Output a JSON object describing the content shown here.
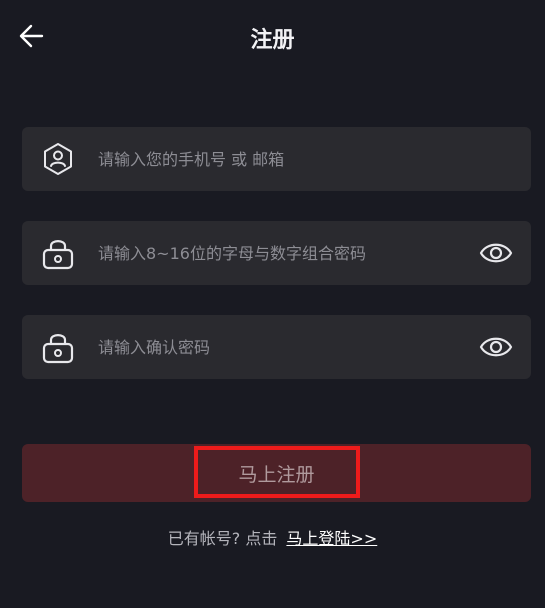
{
  "header": {
    "title": "注册",
    "back_icon": "arrow-left-icon"
  },
  "fields": {
    "account": {
      "placeholder": "请输入您的手机号 或 邮箱",
      "value": "",
      "icon": "user-icon"
    },
    "password": {
      "placeholder": "请输入8~16位的字母与数字组合密码",
      "value": "",
      "icon": "lock-icon",
      "toggle_icon": "eye-icon"
    },
    "confirm": {
      "placeholder": "请输入确认密码",
      "value": "",
      "icon": "lock-icon",
      "toggle_icon": "eye-icon"
    }
  },
  "submit": {
    "label": "马上注册"
  },
  "footer": {
    "prompt": "已有帐号? 点击",
    "link": "马上登陆>>"
  },
  "colors": {
    "background": "#191a22",
    "field_bg": "#2a2a2f",
    "button_bg": "#4d2228",
    "highlight": "#ee1b1b"
  }
}
